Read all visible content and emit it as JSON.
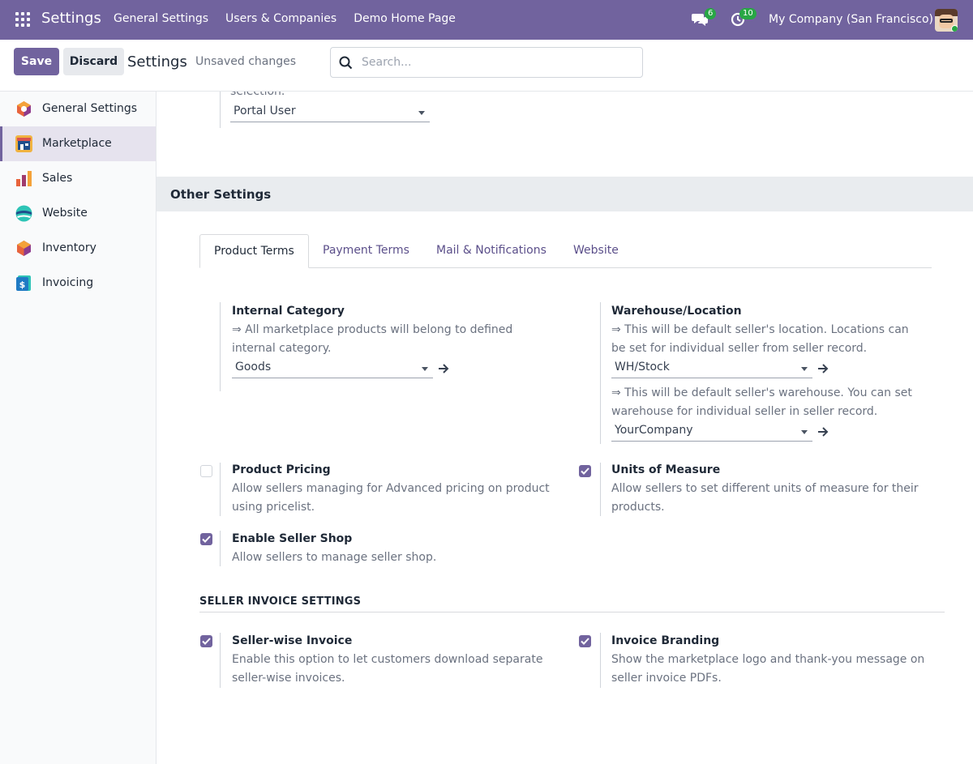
{
  "navbar": {
    "brand": "Settings",
    "menu": [
      "General Settings",
      "Users & Companies",
      "Demo Home Page"
    ],
    "chat_count": "6",
    "activity_count": "10",
    "company": "My Company (San Francisco)"
  },
  "control": {
    "save_label": "Save",
    "discard_label": "Discard",
    "title": "Settings",
    "status": "Unsaved changes",
    "search_placeholder": "Search..."
  },
  "sidebar": {
    "items": [
      {
        "label": "General Settings",
        "icon": "general-settings-icon"
      },
      {
        "label": "Marketplace",
        "icon": "marketplace-icon",
        "active": true
      },
      {
        "label": "Sales",
        "icon": "sales-icon"
      },
      {
        "label": "Website",
        "icon": "website-icon"
      },
      {
        "label": "Inventory",
        "icon": "inventory-icon"
      },
      {
        "label": "Invoicing",
        "icon": "invoicing-icon"
      }
    ]
  },
  "top_partial": {
    "text": "selection.",
    "select_value": "Portal User"
  },
  "section": {
    "title": "Other Settings",
    "tabs": [
      "Product Terms",
      "Payment Terms",
      "Mail & Notifications",
      "Website"
    ],
    "internal_category": {
      "title": "Internal Category",
      "desc": "⇒ All marketplace products will belong to defined internal category.",
      "value": "Goods"
    },
    "warehouse": {
      "title": "Warehouse/Location",
      "desc_location": "⇒ This will be default seller's location. Locations can be set for individual seller from seller record.",
      "location_value": "WH/Stock",
      "desc_warehouse": "⇒ This will be default seller's warehouse. You can set warehouse for individual seller in seller record.",
      "warehouse_value": "YourCompany"
    },
    "product_pricing": {
      "title": "Product Pricing",
      "desc": "Allow sellers managing for Advanced pricing on product using pricelist.",
      "checked": false
    },
    "units_of_measure": {
      "title": "Units of Measure",
      "desc": "Allow sellers to set different units of measure for their products.",
      "checked": true
    },
    "seller_shop": {
      "title": "Enable Seller Shop",
      "desc": "Allow sellers to manage seller shop.",
      "checked": true
    }
  },
  "invoice": {
    "header": "SELLER INVOICE SETTINGS",
    "seller_wise": {
      "title": "Seller-wise Invoice",
      "desc": "Enable this option to let customers download separate seller-wise invoices.",
      "checked": true
    },
    "branding": {
      "title": "Invoice Branding",
      "desc": "Show the marketplace logo and thank-you message on seller invoice PDFs.",
      "checked": true
    }
  },
  "colors": {
    "navbar": "#71639e",
    "accent": "#71639e",
    "badge": "#28a745"
  }
}
